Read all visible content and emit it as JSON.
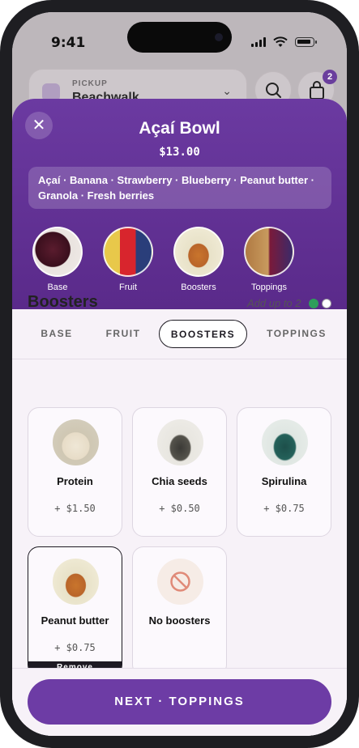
{
  "status": {
    "time": "9:41"
  },
  "background": {
    "pickup_label": "PICKUP",
    "location": "Beachwalk",
    "cart_count": "2"
  },
  "item": {
    "title": "Açaí Bowl",
    "price": "$13.00",
    "ingredients": "Açaí · Banana · Strawberry · Blueberry · Peanut butter · Granola · Fresh berries"
  },
  "categories": [
    {
      "label": "Base"
    },
    {
      "label": "Fruit"
    },
    {
      "label": "Boosters"
    },
    {
      "label": "Toppings"
    }
  ],
  "tabs": [
    {
      "label": "BASE"
    },
    {
      "label": "FRUIT"
    },
    {
      "label": "BOOSTERS",
      "active": true
    },
    {
      "label": "TOPPINGS"
    }
  ],
  "section": {
    "title": "Boosters",
    "limit_text": "Add up to 2",
    "selected_count": 1,
    "max": 2
  },
  "boosters": [
    {
      "name": "Protein",
      "price": "+ $1.50"
    },
    {
      "name": "Chia seeds",
      "price": "+ $0.50"
    },
    {
      "name": "Spirulina",
      "price": "+ $0.75"
    },
    {
      "name": "Peanut butter",
      "price": "+ $0.75",
      "selected": true,
      "remove_label": "Remove"
    },
    {
      "name": "No boosters"
    }
  ],
  "cta": {
    "label": "NEXT · TOPPINGS"
  },
  "colors": {
    "brand": "#6d3ca5",
    "selected_dot": "#2e9e5b"
  }
}
